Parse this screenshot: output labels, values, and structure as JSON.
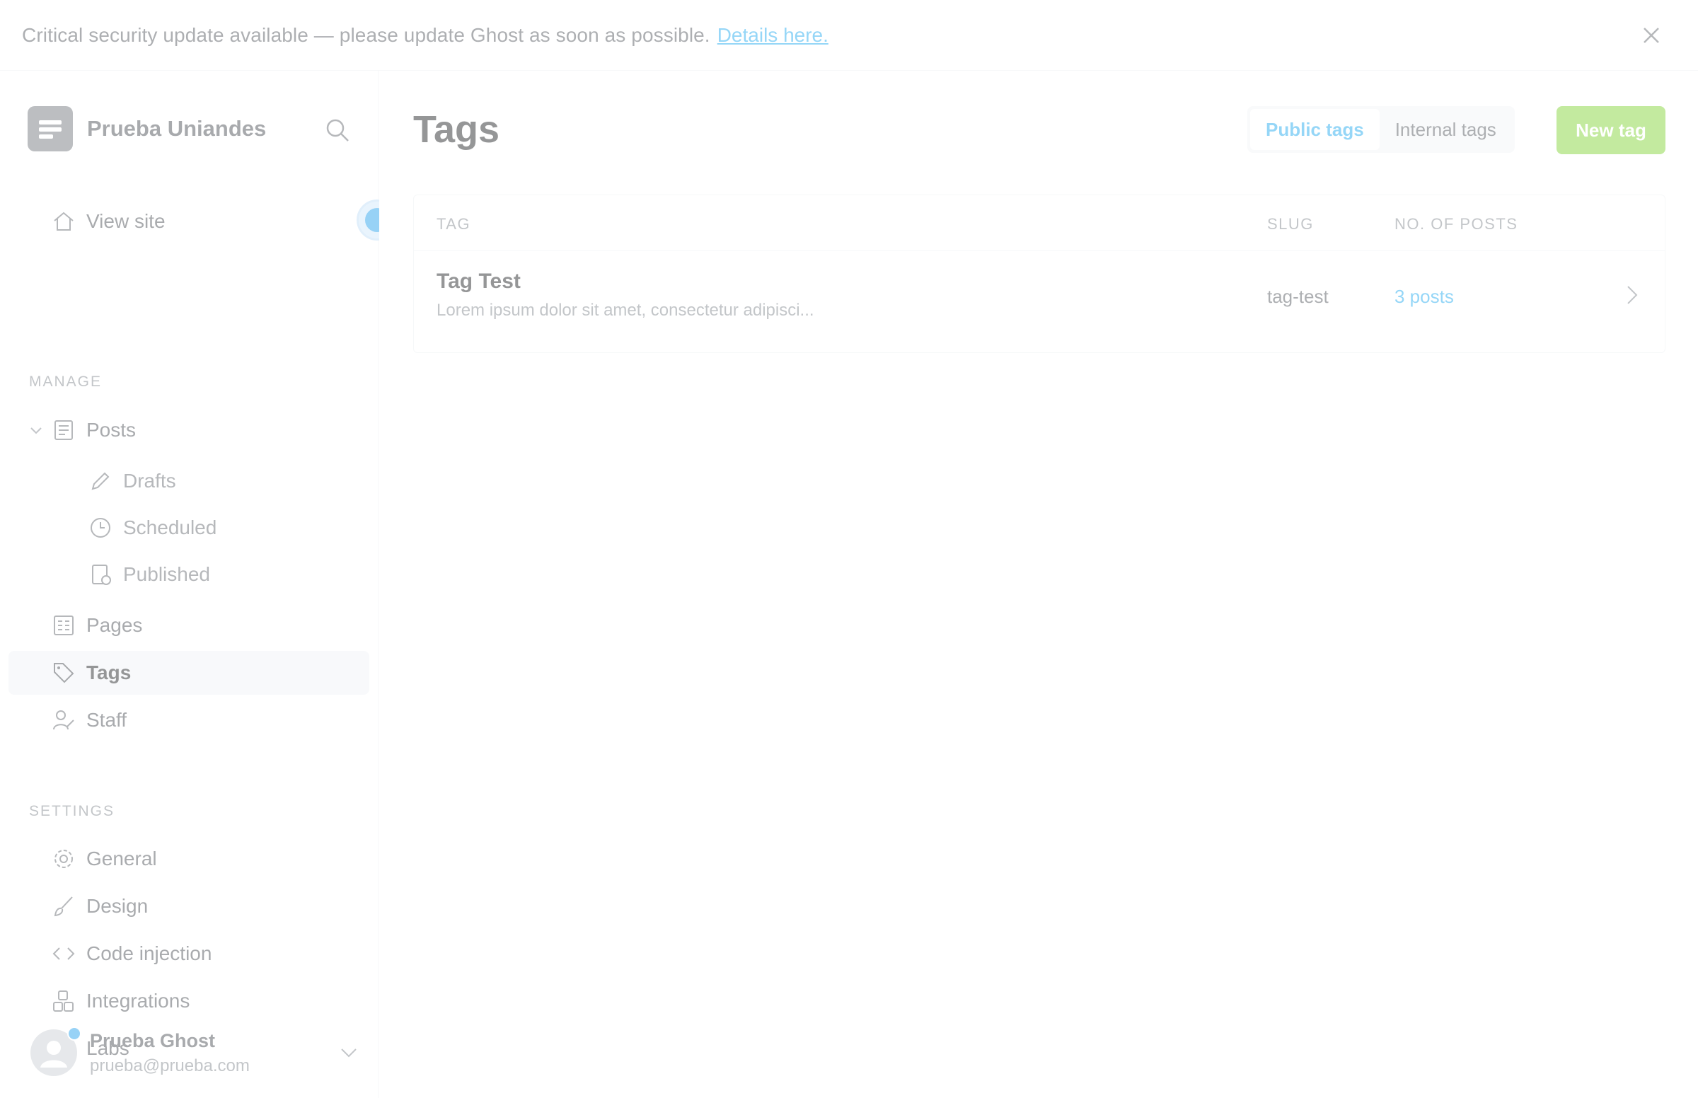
{
  "banner": {
    "text": "Critical security update available — please update Ghost as soon as possible.",
    "link_text": "Details here.",
    "close_icon": "close-icon"
  },
  "sidebar": {
    "brand_name": "Prueba Uniandes",
    "search_icon": "search-icon",
    "view_site": "View site",
    "manage_label": "MANAGE",
    "settings_label": "SETTINGS",
    "manage_items": [
      {
        "label": "Posts",
        "icon": "posts-icon"
      },
      {
        "label": "Drafts",
        "icon": "pencil-icon"
      },
      {
        "label": "Scheduled",
        "icon": "clock-icon"
      },
      {
        "label": "Published",
        "icon": "published-icon"
      },
      {
        "label": "Pages",
        "icon": "pages-icon"
      },
      {
        "label": "Tags",
        "icon": "tag-icon"
      },
      {
        "label": "Staff",
        "icon": "staff-icon"
      }
    ],
    "settings_items": [
      {
        "label": "General",
        "icon": "gear-icon"
      },
      {
        "label": "Design",
        "icon": "brush-icon"
      },
      {
        "label": "Code injection",
        "icon": "code-icon"
      },
      {
        "label": "Integrations",
        "icon": "integrations-icon"
      },
      {
        "label": "Labs",
        "icon": "flask-icon"
      }
    ],
    "user": {
      "name": "Prueba Ghost",
      "email": "prueba@prueba.com"
    }
  },
  "main": {
    "title": "Tags",
    "tabs": [
      {
        "label": "Public tags",
        "active": true
      },
      {
        "label": "Internal tags",
        "active": false
      }
    ],
    "new_tag_label": "New tag",
    "table": {
      "headers": [
        "TAG",
        "SLUG",
        "NO. OF POSTS"
      ],
      "rows": [
        {
          "name": "Tag Test",
          "description": "Lorem ipsum dolor sit amet, consectetur adipisci...",
          "slug": "tag-test",
          "posts": "3 posts"
        }
      ]
    }
  },
  "colors": {
    "accent": "#14a4ee",
    "green": "#7ad12a",
    "active_bg": "#eff2f5"
  }
}
